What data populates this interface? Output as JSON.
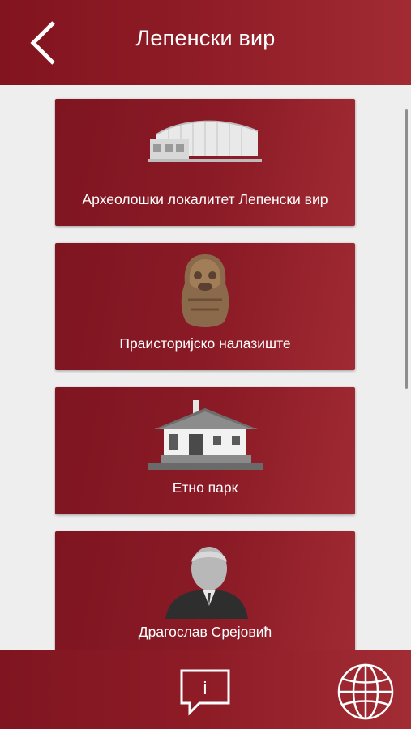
{
  "header": {
    "title": "Лепенски вир",
    "back_icon": "chevron-left-icon"
  },
  "cards": [
    {
      "label": "Археолошки локалитет Лепенски вир",
      "image": "museum-building-image"
    },
    {
      "label": "Праисторијско налазиште",
      "image": "stone-sculpture-image"
    },
    {
      "label": "Етно парк",
      "image": "ethno-house-image"
    },
    {
      "label": "Драгослав Срејовић",
      "image": "portrait-photo-image"
    }
  ],
  "footer": {
    "info_icon": "info-speech-bubble-icon",
    "info_glyph": "i",
    "globe_icon": "globe-icon"
  },
  "colors": {
    "brand_red": "#8e1c27",
    "background": "#eeeeee"
  }
}
